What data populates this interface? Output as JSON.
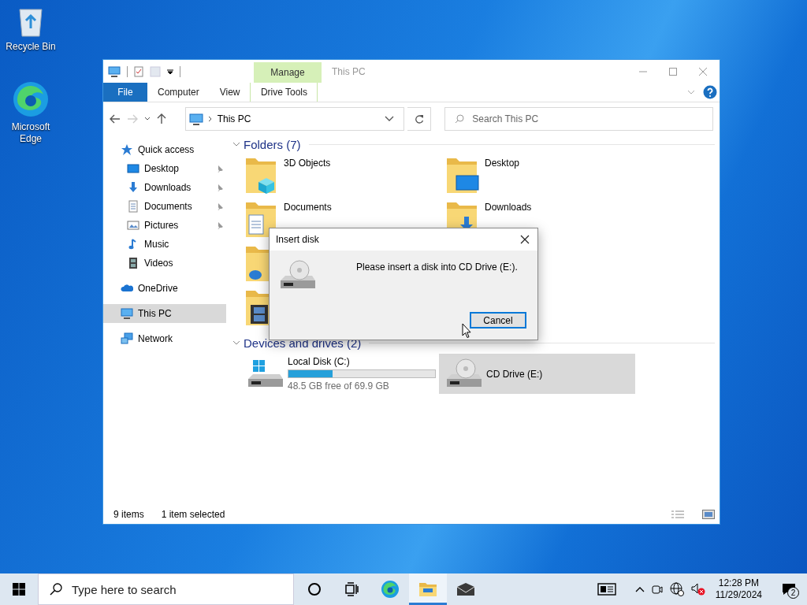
{
  "desktop_icons": [
    {
      "label": "Recycle Bin",
      "kind": "bin"
    },
    {
      "label": "Microsoft Edge",
      "kind": "edge"
    }
  ],
  "window": {
    "title": "This PC",
    "contextual_tab": "Manage",
    "ribbon_tabs": [
      {
        "label": "File",
        "kind": "file",
        "selected": false
      },
      {
        "label": "Computer",
        "kind": "tab",
        "selected": false
      },
      {
        "label": "View",
        "kind": "tab",
        "selected": false
      },
      {
        "label": "Drive Tools",
        "kind": "contextual",
        "selected": false
      }
    ],
    "address": "This PC",
    "search_placeholder": "Search This PC"
  },
  "sidebar": {
    "items": [
      {
        "label": "Quick access",
        "kind": "star",
        "selected": false,
        "children": [
          {
            "label": "Desktop",
            "kind": "desktop",
            "pinned": true,
            "selected": false
          },
          {
            "label": "Downloads",
            "kind": "download",
            "pinned": true,
            "selected": false
          },
          {
            "label": "Documents",
            "kind": "document",
            "pinned": true,
            "selected": false
          },
          {
            "label": "Pictures",
            "kind": "pictures",
            "pinned": true,
            "selected": false
          },
          {
            "label": "Music",
            "kind": "music",
            "pinned": false,
            "selected": false
          },
          {
            "label": "Videos",
            "kind": "video",
            "pinned": false,
            "selected": false
          }
        ]
      },
      {
        "label": "OneDrive",
        "kind": "cloud",
        "selected": false
      },
      {
        "label": "This PC",
        "kind": "pc",
        "selected": true
      },
      {
        "label": "Network",
        "kind": "network",
        "selected": false
      }
    ]
  },
  "folders": {
    "title": "Folders (7)",
    "expanded": true,
    "rows": [
      [
        {
          "name": "3D Objects",
          "kind": "cube"
        },
        {
          "name": "Desktop",
          "kind": "desktop"
        }
      ],
      [
        {
          "name": "Documents",
          "kind": "document"
        },
        {
          "name": "Downloads",
          "kind": "download"
        }
      ],
      [
        {
          "kind": "music"
        }
      ],
      [
        {
          "kind": "video"
        }
      ]
    ]
  },
  "drives": {
    "title": "Devices and drives (2)",
    "expanded": true,
    "items": [
      {
        "name": "Local Disk (C:)",
        "kind": "system",
        "level": 0.3,
        "free": "48.5 GB free of 69.9 GB",
        "selected": false
      },
      {
        "name": "CD Drive (E:)",
        "kind": "optical",
        "selected": true
      }
    ]
  },
  "status_bar": {
    "item_count": "9 items",
    "selection": "1 item selected"
  },
  "dialog": {
    "title": "Insert disk",
    "message": "Please insert a disk into CD Drive (E:).",
    "buttons": [
      {
        "label": "Cancel",
        "default": true
      }
    ]
  },
  "taskbar": {
    "search_placeholder": "Type here to search",
    "apps": [
      {
        "kind": "cortana",
        "active": false
      },
      {
        "kind": "taskview",
        "active": false
      },
      {
        "kind": "edge",
        "active": false
      },
      {
        "kind": "explorer",
        "active": true
      },
      {
        "kind": "mail",
        "active": false
      }
    ],
    "time": "12:28 PM",
    "date": "11/29/2024",
    "notification_count": "2"
  }
}
